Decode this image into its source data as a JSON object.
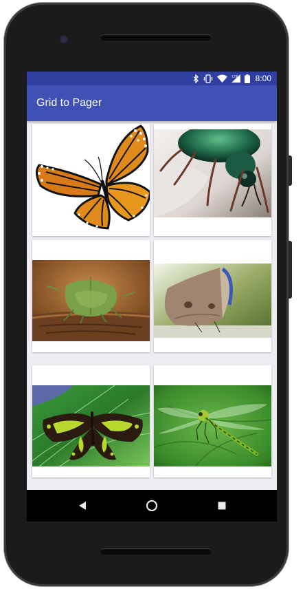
{
  "status_bar": {
    "time": "8:00",
    "icons": [
      "bluetooth-icon",
      "vibrate-icon",
      "wifi-icon",
      "lte-icon",
      "battery-icon"
    ],
    "color": "#303f9f"
  },
  "app_bar": {
    "title": "Grid to Pager",
    "color": "#3f51b5"
  },
  "grid": {
    "items": [
      {
        "subject": "monarch-butterfly"
      },
      {
        "subject": "green-beetle"
      },
      {
        "subject": "green-stink-bug"
      },
      {
        "subject": "brown-butterfly"
      },
      {
        "subject": "malachite-butterfly"
      },
      {
        "subject": "green-dragonfly"
      }
    ]
  },
  "nav_bar": {
    "buttons": [
      "back-icon",
      "home-icon",
      "recents-icon"
    ]
  }
}
